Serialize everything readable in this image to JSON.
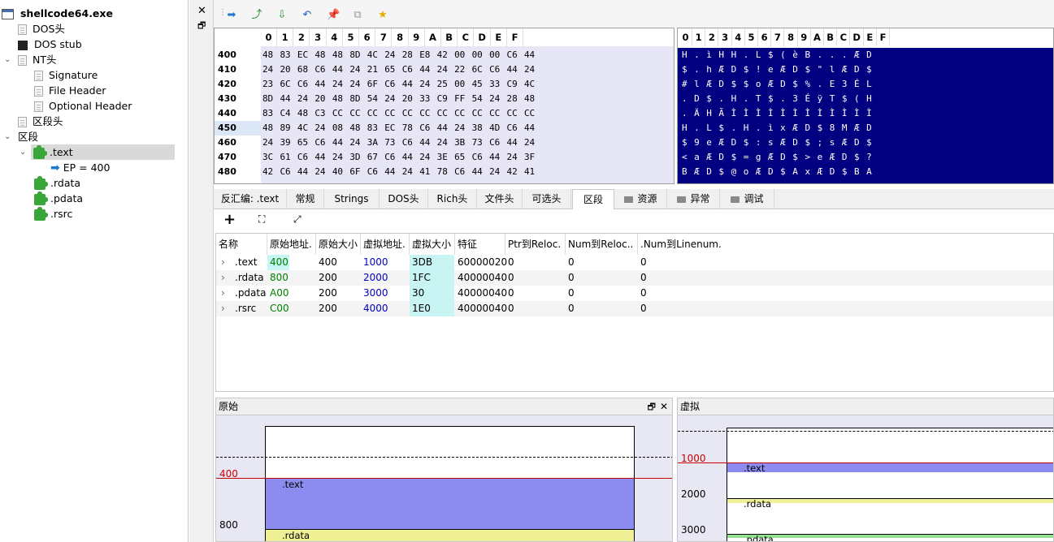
{
  "tree": {
    "root": "shellcode64.exe",
    "items": [
      {
        "label": "DOS头"
      },
      {
        "label": "DOS stub"
      },
      {
        "label": "NT头"
      },
      {
        "label": "Signature"
      },
      {
        "label": "File Header"
      },
      {
        "label": "Optional Header"
      },
      {
        "label": "区段头"
      },
      {
        "label": "区段"
      },
      {
        "label": ".text"
      },
      {
        "label": "EP = 400"
      },
      {
        "label": ".rdata"
      },
      {
        "label": ".pdata"
      },
      {
        "label": ".rsrc"
      }
    ]
  },
  "hex": {
    "columns": [
      "0",
      "1",
      "2",
      "3",
      "4",
      "5",
      "6",
      "7",
      "8",
      "9",
      "A",
      "B",
      "C",
      "D",
      "E",
      "F"
    ],
    "rows": [
      {
        "addr": "400",
        "bytes": "48 83 EC 48 48 8D 4C 24 28 E8 42 00 00 00 C6 44",
        "ascii": "H . ì H H . L $ ( è B . . . Æ D"
      },
      {
        "addr": "410",
        "bytes": "24 20 68 C6 44 24 21 65 C6 44 24 22 6C C6 44 24",
        "ascii": "$ . h Æ D $ ! e Æ D $ \" l Æ D $"
      },
      {
        "addr": "420",
        "bytes": "23 6C C6 44 24 24 6F C6 44 24 25 00 45 33 C9 4C",
        "ascii": "# l Æ D $ $ o Æ D $ % . E 3 É L"
      },
      {
        "addr": "430",
        "bytes": "8D 44 24 20 48 8D 54 24 20 33 C9 FF 54 24 28 48",
        "ascii": ". D $ . H . T $ . 3 É ÿ T $ ( H"
      },
      {
        "addr": "440",
        "bytes": "83 C4 48 C3 CC CC CC CC CC CC CC CC CC CC CC CC",
        "ascii": ". Ä H Ã Ì Ì Ì Ì Ì Ì Ì Ì Ì Ì Ì Ì"
      },
      {
        "addr": "450",
        "bytes": "48 89 4C 24 08 48 83 EC 78 C6 44 24 38 4D C6 44",
        "ascii": "H . L $ . H . ì x Æ D $ 8 M Æ D"
      },
      {
        "addr": "460",
        "bytes": "24 39 65 C6 44 24 3A 73 C6 44 24 3B 73 C6 44 24",
        "ascii": "$ 9 e Æ D $ : s Æ D $ ; s Æ D $"
      },
      {
        "addr": "470",
        "bytes": "3C 61 C6 44 24 3D 67 C6 44 24 3E 65 C6 44 24 3F",
        "ascii": "< a Æ D $ = g Æ D $ > e Æ D $ ?"
      },
      {
        "addr": "480",
        "bytes": "42 C6 44 24 40 6F C6 44 24 41 78 C6 44 24 42 41",
        "ascii": "B Æ D $ @ o Æ D $ A x Æ D $ B A"
      }
    ]
  },
  "tabs": [
    {
      "label": "反汇编: .text"
    },
    {
      "label": "常规"
    },
    {
      "label": "Strings"
    },
    {
      "label": "DOS头"
    },
    {
      "label": "Rich头"
    },
    {
      "label": "文件头"
    },
    {
      "label": "可选头"
    },
    {
      "label": "区段"
    },
    {
      "label": "资源"
    },
    {
      "label": "异常"
    },
    {
      "label": "调试"
    }
  ],
  "table": {
    "headers": [
      "名称",
      "原始地址.",
      "原始大小",
      "虚拟地址.",
      "虚拟大小",
      "特征",
      "Ptr到Reloc.",
      "Num到Reloc..",
      ".Num到Linenum."
    ],
    "rows": [
      {
        "name": ".text",
        "raw_addr": "400",
        "raw_size": "400",
        "virt_addr": "1000",
        "virt_size": "3DB",
        "chars": "60000020",
        "ptr_reloc": "0",
        "num_reloc": "0",
        "num_line": "0"
      },
      {
        "name": ".rdata",
        "raw_addr": "800",
        "raw_size": "200",
        "virt_addr": "2000",
        "virt_size": "1FC",
        "chars": "40000040",
        "ptr_reloc": "0",
        "num_reloc": "0",
        "num_line": "0"
      },
      {
        "name": ".pdata",
        "raw_addr": "A00",
        "raw_size": "200",
        "virt_addr": "3000",
        "virt_size": "30",
        "chars": "40000040",
        "ptr_reloc": "0",
        "num_reloc": "0",
        "num_line": "0"
      },
      {
        "name": ".rsrc",
        "raw_addr": "C00",
        "raw_size": "200",
        "virt_addr": "4000",
        "virt_size": "1E0",
        "chars": "40000040",
        "ptr_reloc": "0",
        "num_reloc": "0",
        "num_line": "0"
      }
    ]
  },
  "raw_pane": {
    "title": "原始",
    "ticks": [
      "400",
      "800"
    ],
    "sections": [
      ".text",
      ".rdata"
    ]
  },
  "virtual_pane": {
    "title": "虚拟",
    "ticks": [
      "1000",
      "2000",
      "3000"
    ],
    "sections": [
      ".text",
      ".rdata",
      ".pdata"
    ]
  },
  "colors": {
    "ascii_bg": "#000080",
    "hex_bg": "#e6e6f6",
    "raw_addr": "#008000",
    "virt_addr": "#0000c8",
    "virt_size_bg": "#c8f4f4",
    "text_section": "#8c8cf0",
    "rdata_section": "#f0f096",
    "pdata_section": "#90e090",
    "marker": "#c80000"
  }
}
